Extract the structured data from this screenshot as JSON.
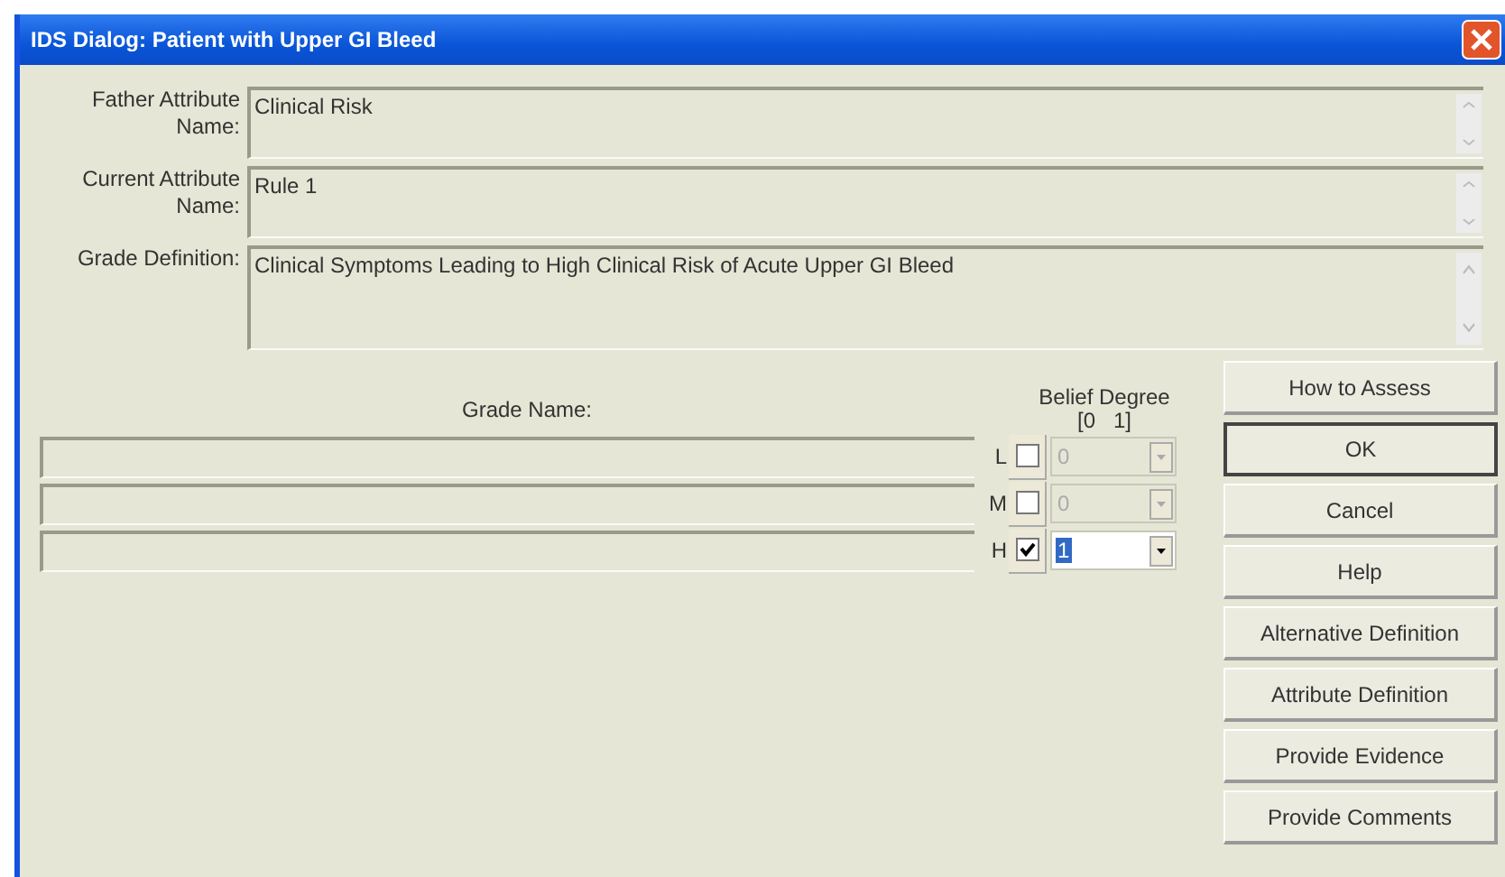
{
  "window": {
    "title": "IDS Dialog: Patient with Upper GI Bleed"
  },
  "fields": [
    {
      "label": "Father Attribute Name:",
      "value": "Clinical Risk"
    },
    {
      "label": "Current Attribute Name:",
      "value": "Rule 1"
    },
    {
      "label": "Grade Definition:",
      "value": "Clinical Symptoms Leading to High Clinical Risk of Acute Upper GI Bleed"
    }
  ],
  "grade_header": "Grade Name:",
  "belief_header": [
    "Belief Degree",
    "[0   1]"
  ],
  "grades": [
    {
      "letter": "L",
      "checked": false,
      "value": "0"
    },
    {
      "letter": "M",
      "checked": false,
      "value": "0"
    },
    {
      "letter": "H",
      "checked": true,
      "value": "1"
    }
  ],
  "buttons": [
    {
      "label": "How to Assess",
      "default": false
    },
    {
      "label": "OK",
      "default": true
    },
    {
      "label": "Cancel",
      "default": false
    },
    {
      "label": "Help",
      "default": false
    },
    {
      "label": "Alternative Definition",
      "default": false
    },
    {
      "label": "Attribute Definition",
      "default": false
    },
    {
      "label": "Provide Evidence",
      "default": false
    },
    {
      "label": "Provide Comments",
      "default": false
    }
  ]
}
